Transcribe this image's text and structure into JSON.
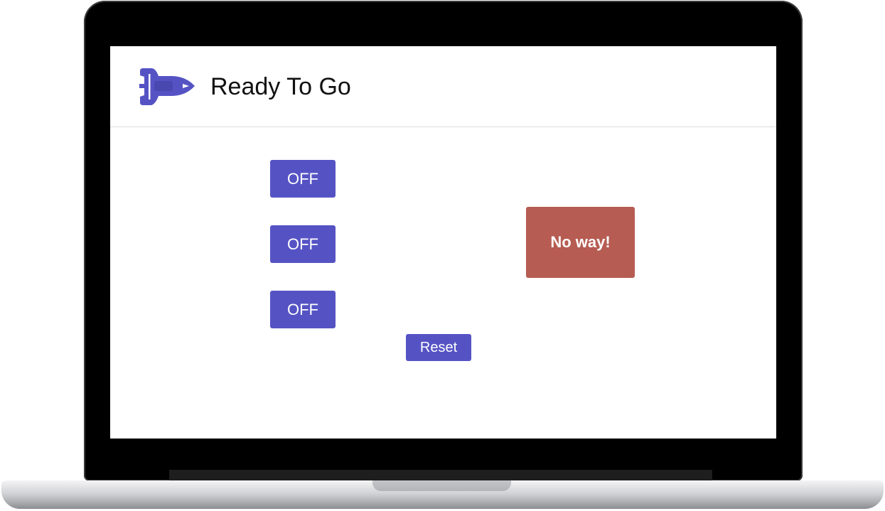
{
  "app": {
    "title": "Ready To Go",
    "logo_icon": "space-shuttle-icon",
    "accent_color": "#5553c4"
  },
  "toggles": [
    {
      "label": "OFF"
    },
    {
      "label": "OFF"
    },
    {
      "label": "OFF"
    }
  ],
  "reset": {
    "label": "Reset"
  },
  "status": {
    "text": "No way!",
    "color": "#b65c52"
  }
}
